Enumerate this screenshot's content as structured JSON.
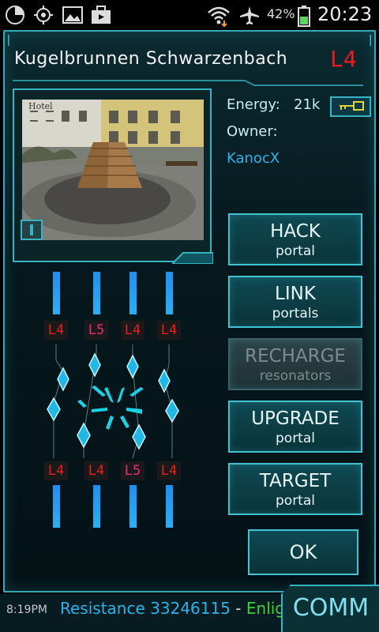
{
  "status_bar": {
    "battery_percent": "42%",
    "clock": "20:23",
    "icons": [
      "pie-chart-icon",
      "gps-target-icon",
      "image-icon",
      "briefcase-icon",
      "wifi-icon",
      "airplane-mode-icon",
      "battery-icon"
    ]
  },
  "portal": {
    "name": "Kugelbrunnen Schwarzenbach",
    "level": "L4",
    "photo_sign_text": "Hotel",
    "energy_label": "Energy:",
    "energy_value": "21k",
    "owner_label": "Owner:",
    "owner_name": "KanocX"
  },
  "actions": [
    {
      "line1": "HACK",
      "line2": "portal",
      "enabled": true
    },
    {
      "line1": "LINK",
      "line2": "portals",
      "enabled": true
    },
    {
      "line1": "RECHARGE",
      "line2": "resonators",
      "enabled": false
    },
    {
      "line1": "UPGRADE",
      "line2": "portal",
      "enabled": true
    },
    {
      "line1": "TARGET",
      "line2": "portal",
      "enabled": true
    }
  ],
  "ok_label": "OK",
  "resonators": {
    "top_levels": [
      "L4",
      "L5",
      "L4",
      "L4"
    ],
    "bottom_levels": [
      "L4",
      "L4",
      "L5",
      "L4"
    ],
    "level_colors": {
      "L4": "#ee1c1c",
      "L5": "#ef2a7a"
    }
  },
  "bottom_bar": {
    "time": "8:19PM",
    "resistance_label": "Resistance",
    "resistance_score": "33246115",
    "separator": " - ",
    "enlightened_label": "Enligh",
    "comm_label": "COMM"
  },
  "colors": {
    "accent": "#37b4c2",
    "owner_resistance": "#27b4ea",
    "level_red": "#ee1c1c",
    "enlightened_green": "#38d238"
  }
}
